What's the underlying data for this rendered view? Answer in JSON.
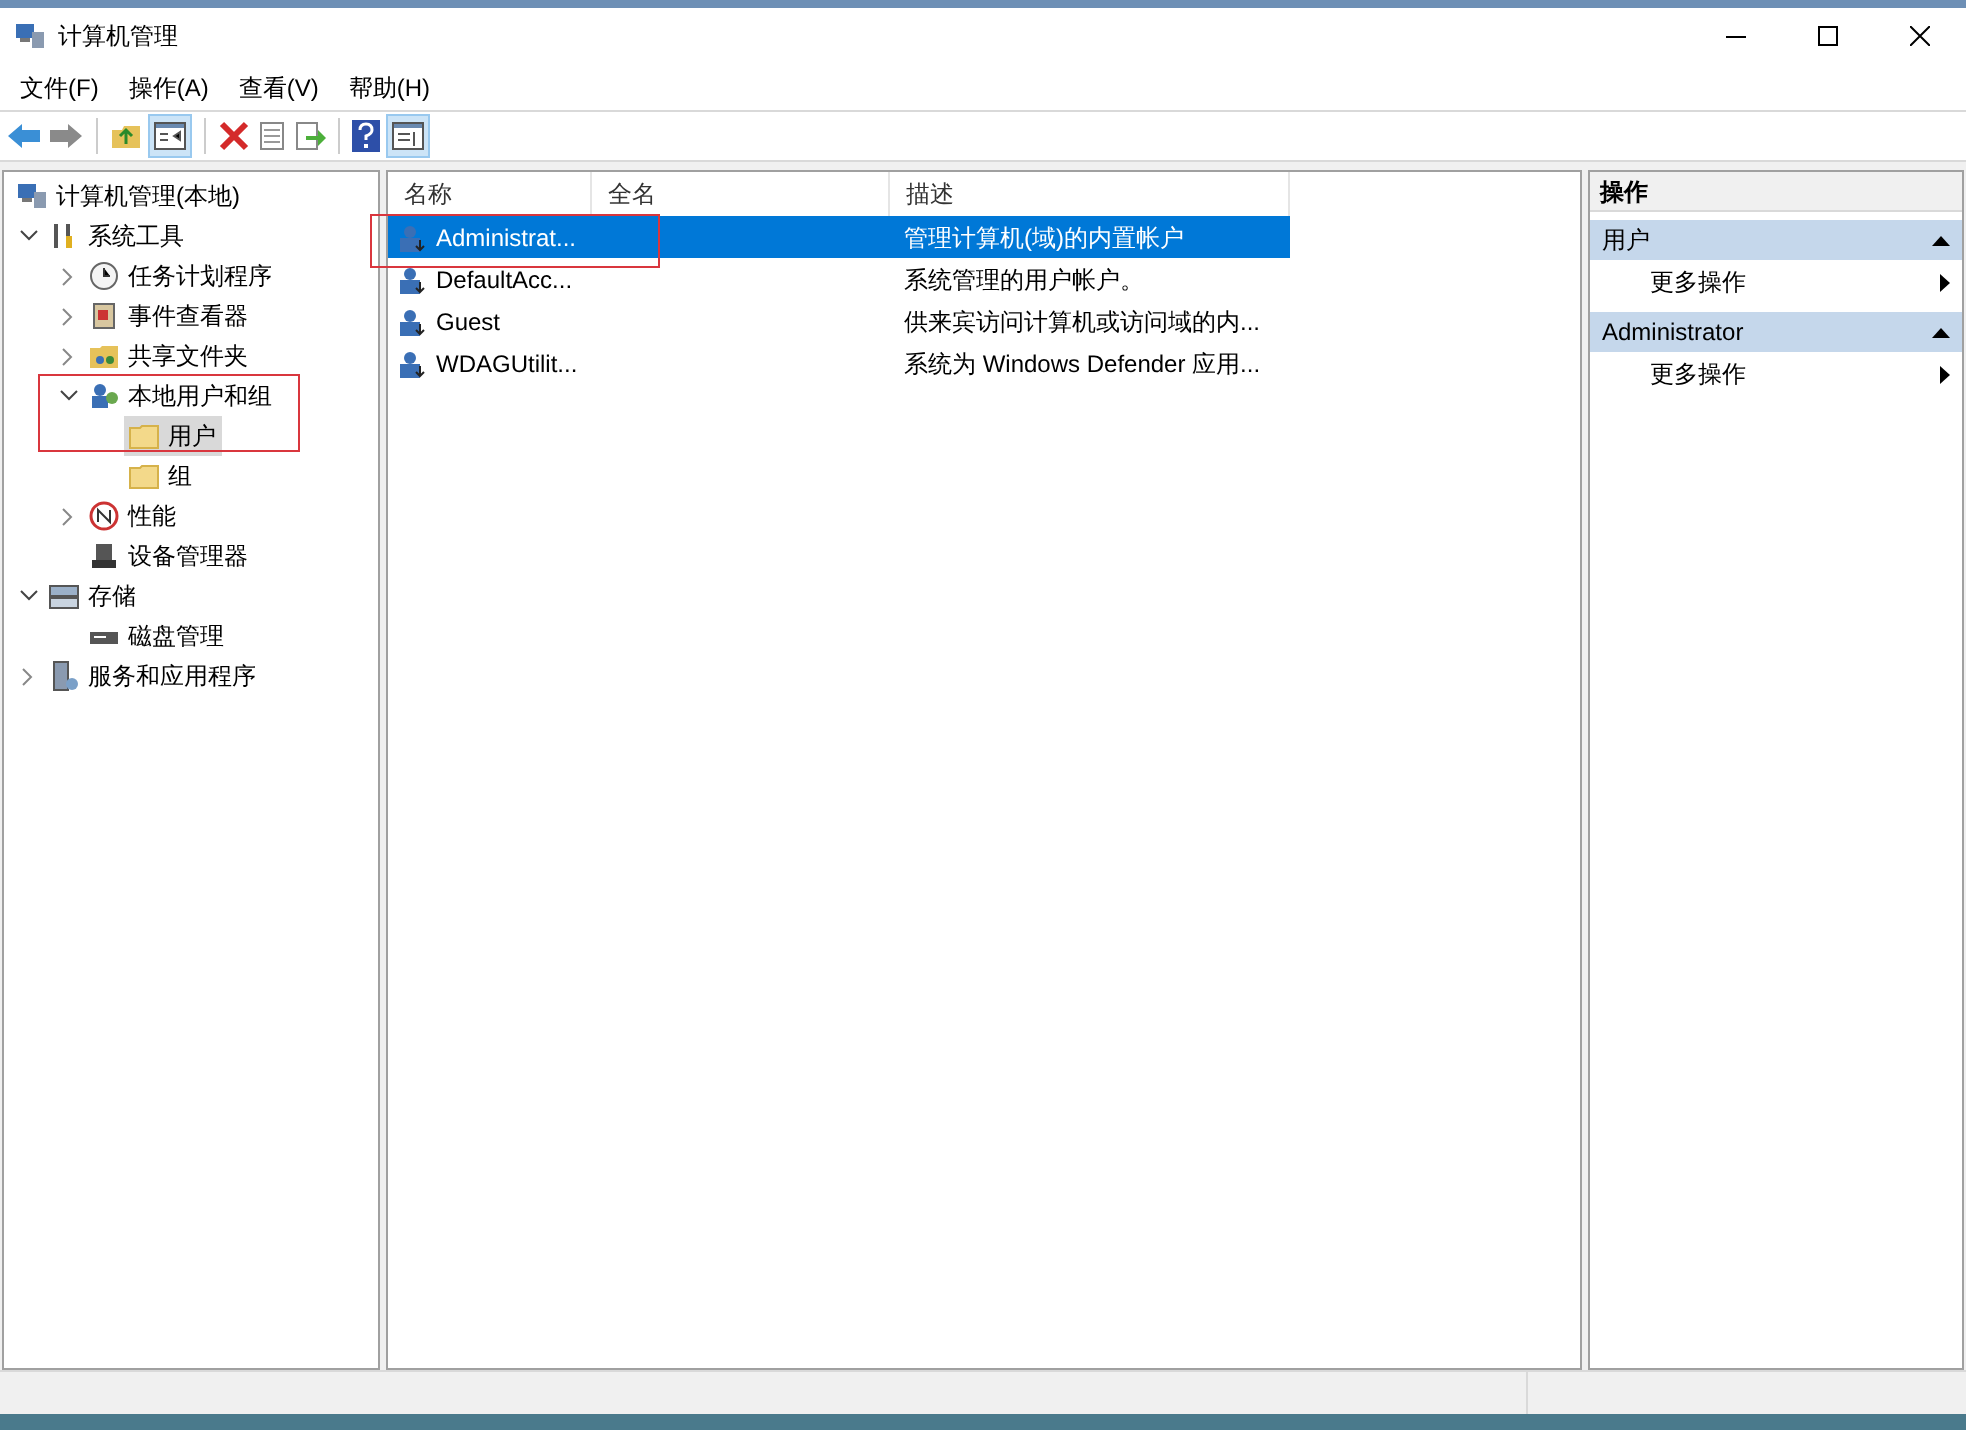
{
  "window": {
    "title": "计算机管理"
  },
  "menu": [
    "文件(F)",
    "操作(A)",
    "查看(V)",
    "帮助(H)"
  ],
  "tree": [
    {
      "label": "计算机管理(本地)",
      "selected": false,
      "children": [
        {
          "label": "系统工具",
          "selected": false,
          "expanded": true,
          "children": [
            {
              "label": "任务计划程序",
              "selected": false,
              "expanded": false
            },
            {
              "label": "事件查看器",
              "selected": false,
              "expanded": false
            },
            {
              "label": "共享文件夹",
              "selected": false,
              "expanded": false
            },
            {
              "label": "本地用户和组",
              "selected": false,
              "expanded": true,
              "children": [
                {
                  "label": "用户",
                  "selected": true
                },
                {
                  "label": "组",
                  "selected": false
                }
              ]
            },
            {
              "label": "性能",
              "selected": false,
              "expanded": false
            },
            {
              "label": "设备管理器",
              "selected": false
            }
          ]
        },
        {
          "label": "存储",
          "selected": false,
          "expanded": true,
          "children": [
            {
              "label": "磁盘管理",
              "selected": false
            }
          ]
        },
        {
          "label": "服务和应用程序",
          "selected": false,
          "expanded": false
        }
      ]
    }
  ],
  "table": {
    "columns": [
      "名称",
      "全名",
      "描述"
    ],
    "rows": [
      {
        "name": "Administrat...",
        "full_name": "",
        "description": "管理计算机(域)的内置帐户",
        "selected": true
      },
      {
        "name": "DefaultAcc...",
        "full_name": "",
        "description": "系统管理的用户帐户。",
        "selected": false
      },
      {
        "name": "Guest",
        "full_name": "",
        "description": "供来宾访问计算机或访问域的内...",
        "selected": false
      },
      {
        "name": "WDAGUtilit...",
        "full_name": "",
        "description": "系统为 Windows Defender 应用...",
        "selected": false
      }
    ]
  },
  "actions": {
    "title": "操作",
    "sections": [
      {
        "title": "用户",
        "expanded": true,
        "items": [
          "更多操作"
        ]
      },
      {
        "title": "Administrator",
        "expanded": true,
        "items": [
          "更多操作"
        ]
      }
    ]
  }
}
